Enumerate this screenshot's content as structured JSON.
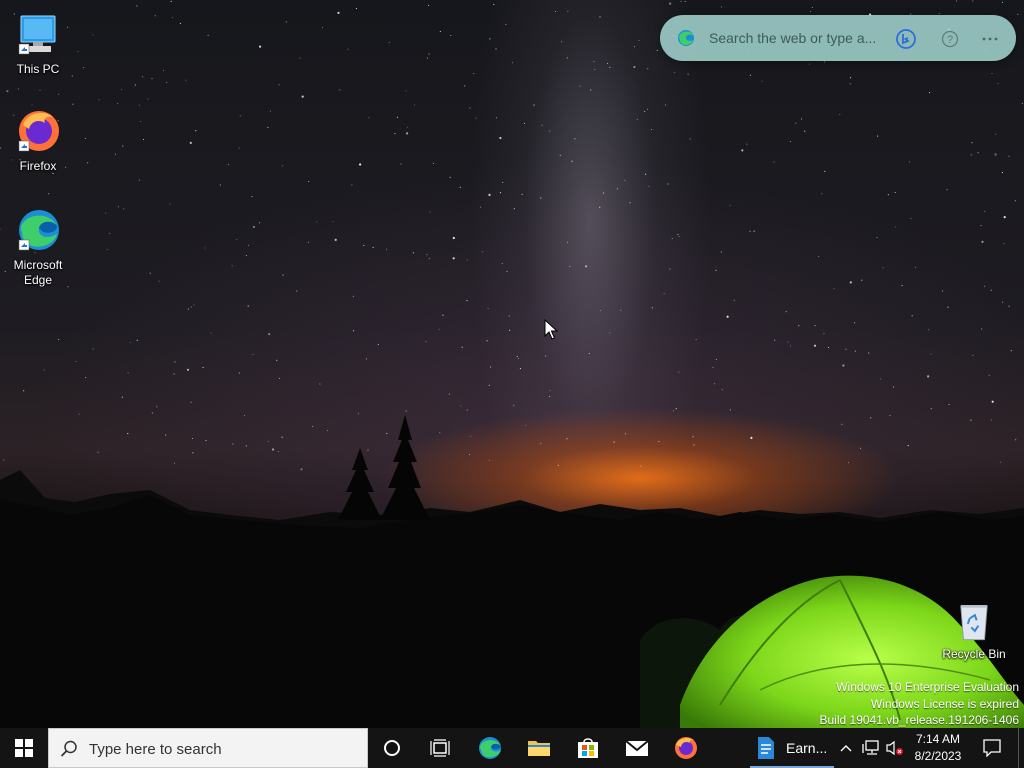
{
  "desktop_icons": [
    {
      "name": "this-pc",
      "label": "This PC"
    },
    {
      "name": "firefox",
      "label": "Firefox"
    },
    {
      "name": "microsoft-edge",
      "label": "Microsoft Edge"
    },
    {
      "name": "recycle-bin",
      "label": "Recycle Bin"
    }
  ],
  "edge_search_bar": {
    "placeholder": "Search the web or type a...",
    "bing_icon": "bing-chat-icon",
    "help_icon": "question-icon",
    "more_icon": "ellipsis-icon"
  },
  "watermark": {
    "line1": "Windows 10 Enterprise Evaluation",
    "line2": "Windows License is expired",
    "line3": "Build 19041.vb_release.191206-1406"
  },
  "taskbar": {
    "search_placeholder": "Type here to search",
    "pinned": [
      "cortana-icon",
      "task-view-icon",
      "edge-icon",
      "file-explorer-icon",
      "store-icon",
      "mail-icon",
      "firefox-icon"
    ],
    "running_app_label": "Earn...",
    "tray": {
      "time": "7:14 AM",
      "date": "8/2/2023",
      "icons": [
        "chevron-up-icon",
        "network-icon",
        "volume-muted-icon",
        "notification-icon"
      ]
    }
  },
  "colors": {
    "taskbar_bg": "#141414",
    "search_pill_bg": "#a0d2cd",
    "tent_green": "#8fe02a",
    "accent_blue": "#0078d7"
  }
}
